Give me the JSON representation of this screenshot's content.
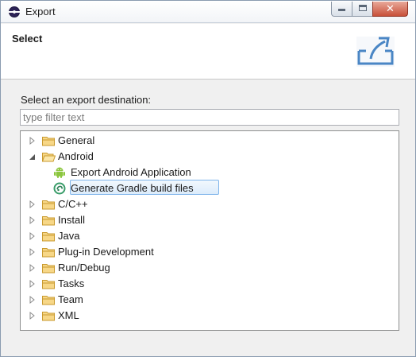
{
  "window": {
    "title": "Export"
  },
  "banner": {
    "title": "Select"
  },
  "main": {
    "prompt": "Select an export destination:",
    "filter": {
      "value": "",
      "placeholder": "type filter text"
    }
  },
  "tree": {
    "general": "General",
    "android": "Android",
    "android_children": [
      "Export Android Application",
      "Generate Gradle build files"
    ],
    "selected_item": "Generate Gradle build files",
    "folders": [
      "C/C++",
      "Install",
      "Java",
      "Plug-in Development",
      "Run/Debug",
      "Tasks",
      "Team",
      "XML"
    ]
  },
  "icons": {
    "title": "eclipse-icon",
    "banner": "export-wizard-icon",
    "folder": "folder-icon",
    "android_app": "android-icon",
    "gradle": "gradle-icon"
  },
  "colors": {
    "selection_border": "#7eb4ea",
    "folder": "#e8b545",
    "android_green": "#8cc63f",
    "gradle_green": "#3a9d6a"
  }
}
